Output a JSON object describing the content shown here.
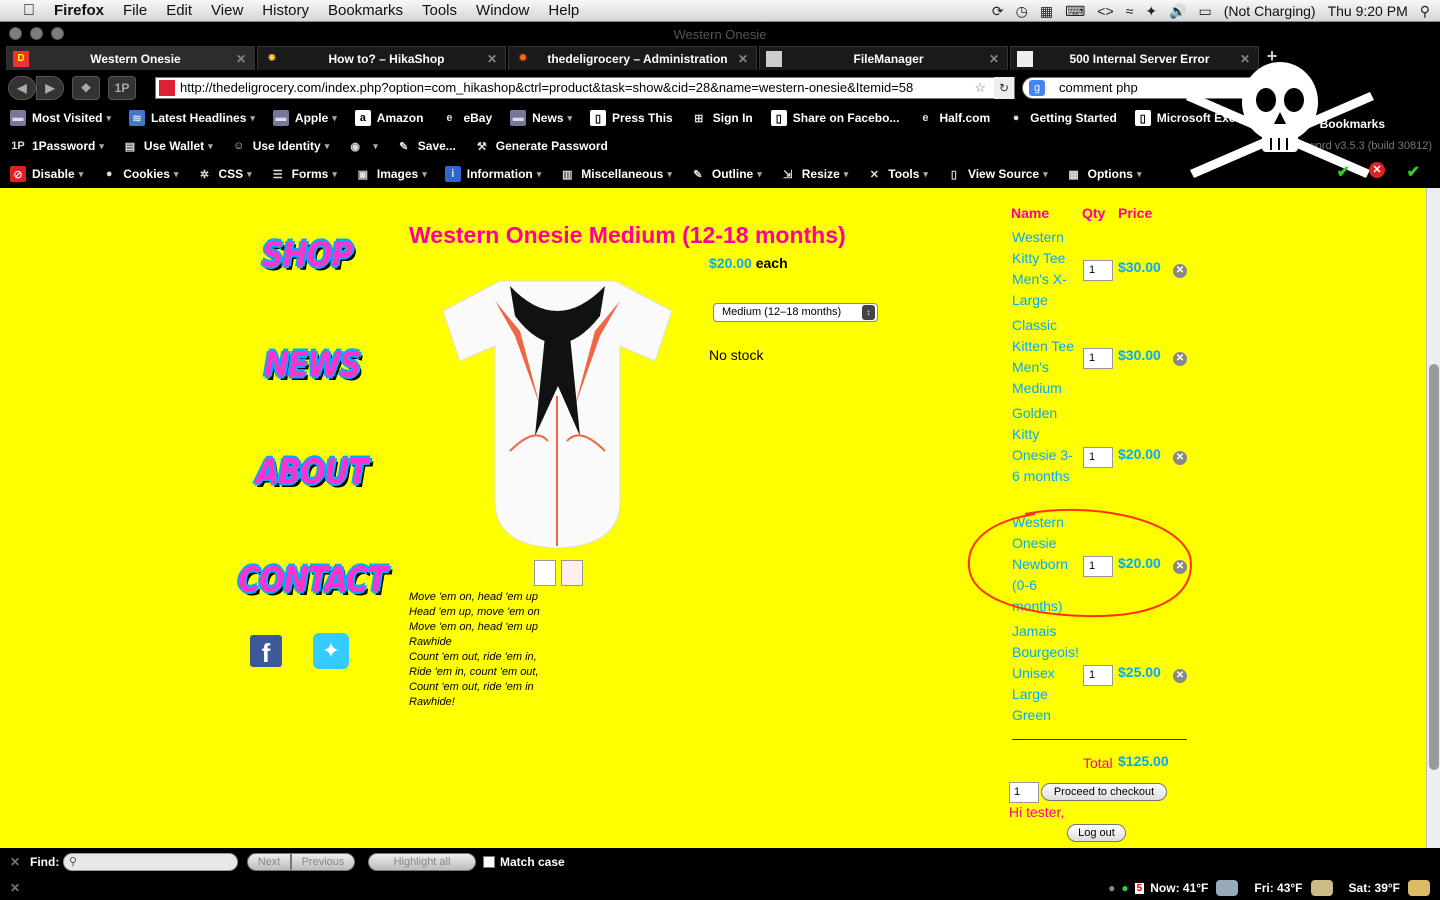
{
  "menubar": {
    "app": "Firefox",
    "items": [
      "File",
      "Edit",
      "View",
      "History",
      "Bookmarks",
      "Tools",
      "Window",
      "Help"
    ],
    "battery": "(Not Charging)",
    "clock": "Thu 9:20 PM"
  },
  "window": {
    "title": "Western Onesie"
  },
  "tabs": [
    {
      "label": "Western Onesie",
      "active": true
    },
    {
      "label": "How to? – HikaShop"
    },
    {
      "label": "thedeligrocery – Administration"
    },
    {
      "label": "FileManager"
    },
    {
      "label": "500 Internal Server Error"
    }
  ],
  "nav": {
    "url": "http://thedeligrocery.com/index.php?option=com_hikashop&ctrl=product&task=show&cid=28&name=western-onesie&Itemid=58",
    "search": "comment php"
  },
  "bookmarks": [
    {
      "label": "Most Visited",
      "icon": "folder-icon",
      "dd": true
    },
    {
      "label": "Latest Headlines",
      "icon": "rss-icon",
      "dd": true
    },
    {
      "label": "Apple",
      "icon": "folder-icon",
      "dd": true
    },
    {
      "label": "Amazon",
      "icon": "amazon-icon"
    },
    {
      "label": "eBay",
      "icon": "ebay-icon"
    },
    {
      "label": "News",
      "icon": "folder-icon",
      "dd": true
    },
    {
      "label": "Press This",
      "icon": "page-icon"
    },
    {
      "label": "Sign In",
      "icon": "windows-icon"
    },
    {
      "label": "Share on Facebo...",
      "icon": "page-icon"
    },
    {
      "label": "Half.com",
      "icon": "ebay-icon"
    },
    {
      "label": "Getting Started",
      "icon": "firefox-icon"
    },
    {
      "label": "Microsoft Excha...",
      "icon": "page-icon"
    }
  ],
  "bookmarks_right": "Bookmarks",
  "onepassword": [
    {
      "label": "1Password",
      "icon": "1p-icon",
      "dd": true
    },
    {
      "label": "Use Wallet",
      "icon": "wallet-icon",
      "dd": true
    },
    {
      "label": "Use Identity",
      "icon": "identity-icon",
      "dd": true
    },
    {
      "label": "",
      "icon": "logo-icon",
      "dd": true
    },
    {
      "label": "Save...",
      "icon": "save-icon"
    },
    {
      "label": "Generate Password",
      "icon": "key-icon"
    }
  ],
  "onepassword_version": "1Password v3.5.3 (build 30812)",
  "webdev": [
    {
      "label": "Disable",
      "icon": "disable-icon",
      "dd": true
    },
    {
      "label": "Cookies",
      "icon": "cookie-icon",
      "dd": true
    },
    {
      "label": "CSS",
      "icon": "css-icon",
      "dd": true
    },
    {
      "label": "Forms",
      "icon": "forms-icon",
      "dd": true
    },
    {
      "label": "Images",
      "icon": "images-icon",
      "dd": true
    },
    {
      "label": "Information",
      "icon": "info-icon",
      "dd": true
    },
    {
      "label": "Miscellaneous",
      "icon": "misc-icon",
      "dd": true
    },
    {
      "label": "Outline",
      "icon": "outline-icon",
      "dd": true
    },
    {
      "label": "Resize",
      "icon": "resize-icon",
      "dd": true
    },
    {
      "label": "Tools",
      "icon": "tools-icon",
      "dd": true
    },
    {
      "label": "View Source",
      "icon": "source-icon",
      "dd": true
    },
    {
      "label": "Options",
      "icon": "options-icon",
      "dd": true
    }
  ],
  "site_nav": {
    "shop": "SHOP",
    "news": "NEWS",
    "about": "ABOUT",
    "contact": "CONTACT"
  },
  "product": {
    "title": "Western Onesie Medium (12-18 months)",
    "price": "$20.00",
    "each": "each",
    "size_selected": "Medium (12–18 months)",
    "stock": "No stock",
    "lyrics": [
      "Move 'em on, head 'em up",
      "Head 'em up, move 'em on",
      "Move 'em on, head 'em up",
      "Rawhide",
      "Count 'em out, ride 'em in,",
      "Ride 'em in, count 'em out,",
      "Count 'em out, ride 'em in",
      "Rawhide!"
    ]
  },
  "cart": {
    "headers": {
      "name": "Name",
      "qty": "Qty",
      "price": "Price"
    },
    "items": [
      {
        "name": "Western Kitty Tee Men's X-Large",
        "qty": "1",
        "price": "$30.00"
      },
      {
        "name": "Classic Kitten Tee Men's Medium",
        "qty": "1",
        "price": "$30.00"
      },
      {
        "name": "Golden Kitty Onesie 3-6 months",
        "qty": "1",
        "price": "$20.00"
      },
      {
        "name": "Western Onesie Newborn (0-6 months)",
        "qty": "1",
        "price": "$20.00"
      },
      {
        "name": "Jamais Bourgeois! Unisex Large Green",
        "qty": "1",
        "price": "$25.00"
      }
    ],
    "total_label": "Total",
    "total": "$125.00",
    "checkout_qty": "1",
    "checkout": "Proceed to checkout",
    "greeting": "Hi tester,",
    "logout": "Log out"
  },
  "findbar": {
    "label": "Find:",
    "next": "Next",
    "previous": "Previous",
    "highlight": "Highlight all",
    "matchcase": "Match case"
  },
  "status": {
    "now": "Now: 41°F",
    "fri": "Fri: 43°F",
    "sat": "Sat: 39°F"
  },
  "colors": {
    "page_bg": "#ffff00",
    "pink": "#ff0099",
    "blue": "#00aaff",
    "annotation": "#ff3300"
  }
}
